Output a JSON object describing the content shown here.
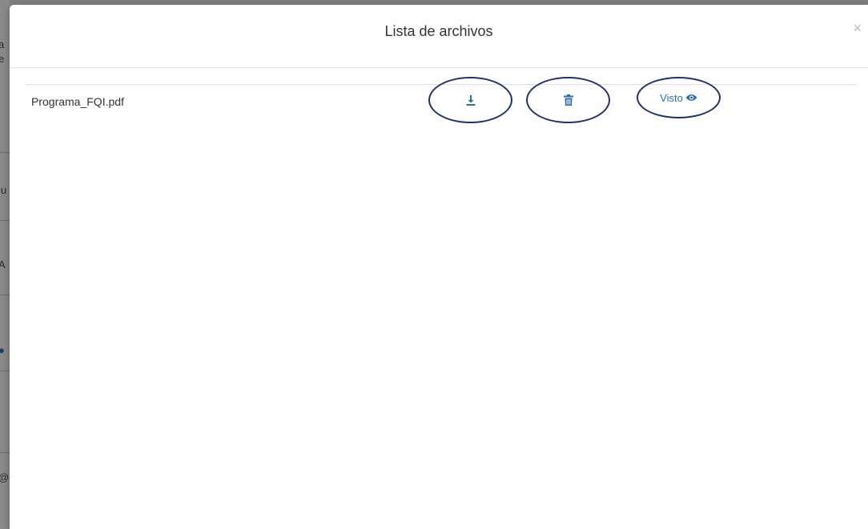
{
  "backdrop": {
    "fragments": [
      "a",
      "e",
      "lu",
      "A",
      "@"
    ]
  },
  "modal": {
    "title": "Lista de archivos",
    "close_label": "×"
  },
  "files": [
    {
      "name": "Programa_FQI.pdf",
      "download_icon": "download-icon",
      "delete_icon": "trash-icon",
      "visto_label": "Visto",
      "visto_icon": "eye-icon"
    }
  ],
  "colors": {
    "accent": "#2f6fa8",
    "annotation_circle": "#1c3370",
    "text": "#333333"
  }
}
